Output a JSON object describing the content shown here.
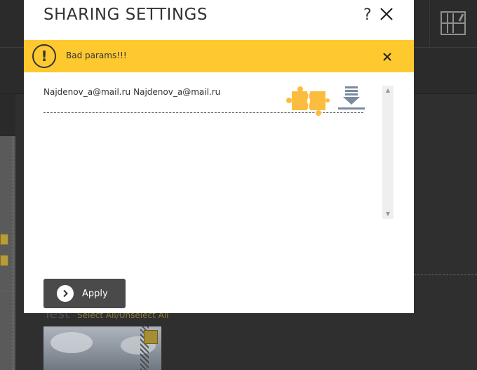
{
  "background": {
    "album_title": "Test",
    "select_all": "Select All",
    "separator": "/",
    "unselect_all": "Unselect All"
  },
  "modal": {
    "title": "SHARING SETTINGS",
    "help_label": "?",
    "alert": {
      "message": "Bad params!!!",
      "icon_label": "!",
      "color": "#fdc92f"
    },
    "shares": [
      {
        "email": "Najdenov_a@mail.ru",
        "name": "Najdenov_a@mail.ru"
      }
    ],
    "apply_label": "Apply"
  },
  "icons": {
    "help": "question-icon",
    "close": "close-icon",
    "alert": "exclamation-icon",
    "permissions": "puzzle-icon",
    "download": "download-icon",
    "apply": "chevron-right-icon",
    "toolbar": "toolbar-icon"
  },
  "colors": {
    "accent": "#fdc92f",
    "puzzle": "#fbbd3e",
    "dark": "#4a4a4a"
  }
}
